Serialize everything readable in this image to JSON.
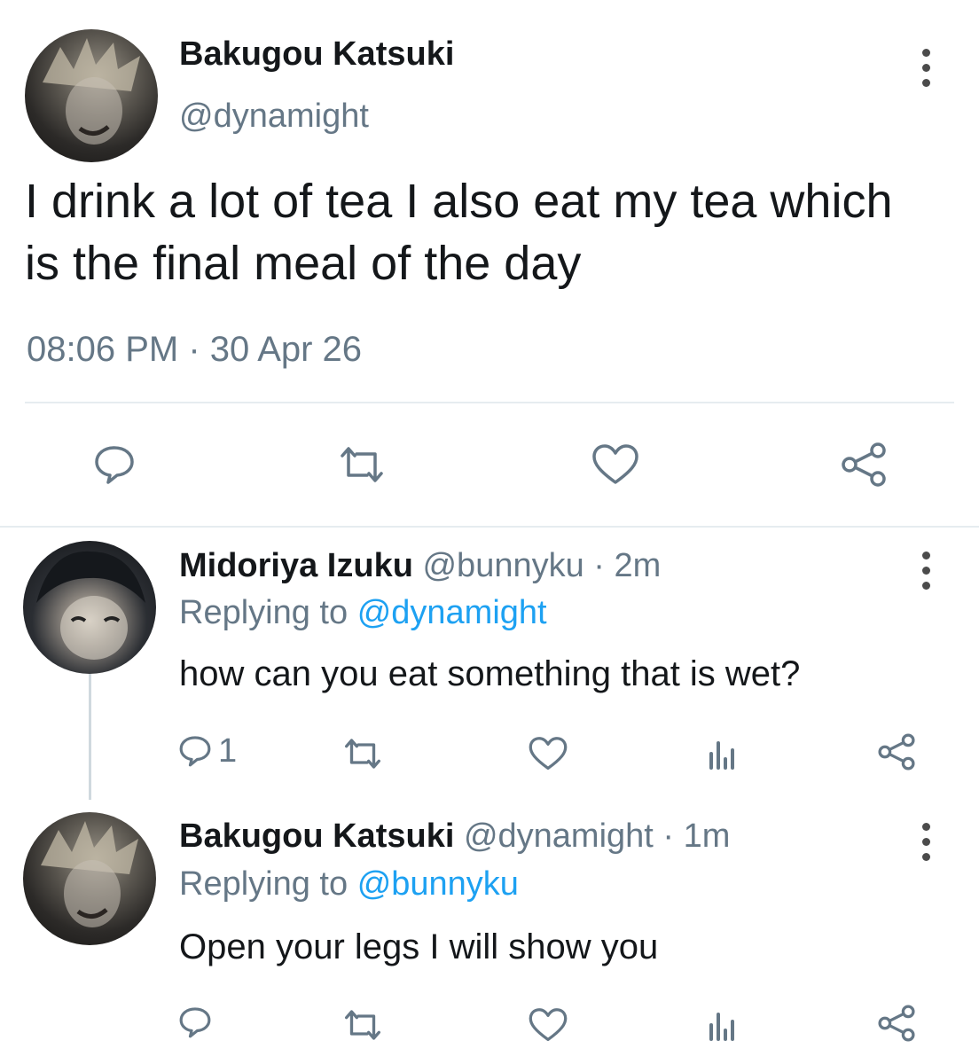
{
  "main_tweet": {
    "display_name": "Bakugou Katsuki",
    "handle": "@dynamight",
    "text_line1": "I drink a lot of tea I also eat my tea which",
    "text_line2": "is the final meal of the day",
    "time": "08:06 PM",
    "separator": "·",
    "date": "30 Apr 26",
    "actions": [
      "reply-icon",
      "retweet-icon",
      "like-icon",
      "share-icon"
    ]
  },
  "replies": [
    {
      "display_name": "Midoriya Izuku",
      "handle": "@bunnyku",
      "age": "· 2m",
      "replying_prefix": "Replying to",
      "replying_to": "@dynamight",
      "text": "how can you eat something that is wet?",
      "reply_count": "1"
    },
    {
      "display_name": "Bakugou Katsuki",
      "handle": "@dynamight",
      "age": "· 1m",
      "replying_prefix": "Replying to",
      "replying_to": "@bunnyku",
      "text": "Open your legs I will show you",
      "reply_count": ""
    }
  ],
  "colors": {
    "link": "#1da1f2",
    "muted": "#657786",
    "icon": "#657786",
    "divider": "#e6ecf0"
  }
}
